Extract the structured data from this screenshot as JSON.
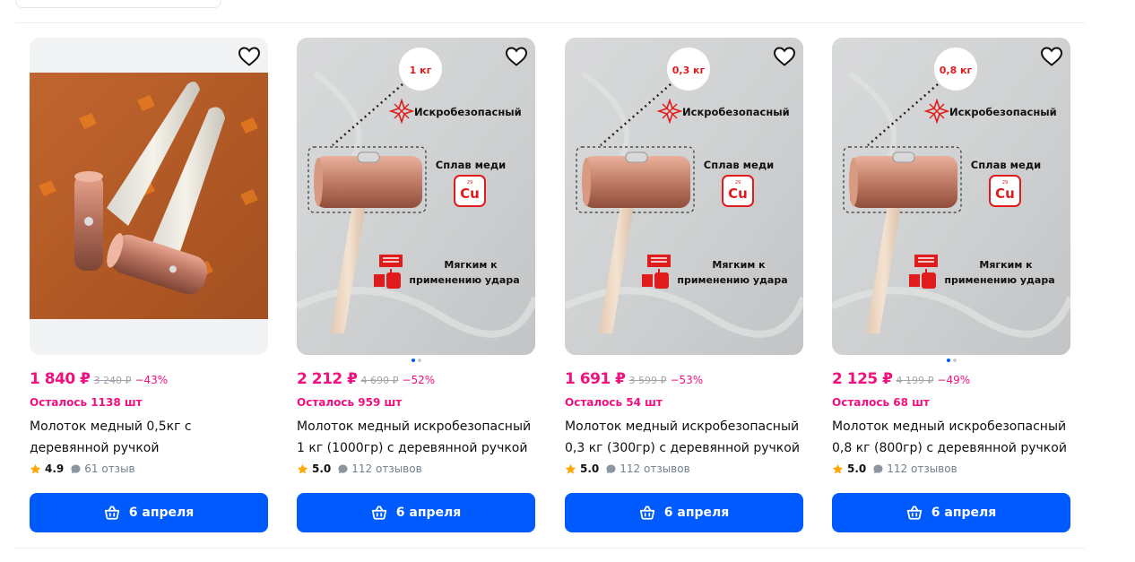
{
  "products": [
    {
      "price": "1 840 ₽",
      "old_price": "3 240 ₽",
      "discount": "−43%",
      "stock": "Осталось 1138 шт",
      "title": "Молоток медный 0,5кг с деревянной ручкой",
      "rating": "4.9",
      "reviews": "61 отзыв",
      "delivery": "6 апреля",
      "image_kind": "photo",
      "image_dots": 0
    },
    {
      "price": "2 212 ₽",
      "old_price": "4 690 ₽",
      "discount": "−52%",
      "stock": "Осталось 959 шт",
      "title": "Молоток медный искробезопасный 1 кг (1000гр) с деревянной ручкой",
      "rating": "5.0",
      "reviews": "112 отзывов",
      "delivery": "6 апреля",
      "image_kind": "infographic",
      "weight_badge": "1 кг",
      "spark_label": "Искробезопасный",
      "alloy_label": "Сплав меди",
      "element_symbol": "Cu",
      "element_number": "29",
      "soft_label": "Мягким к применению удара",
      "image_dots": 2
    },
    {
      "price": "1 691 ₽",
      "old_price": "3 599 ₽",
      "discount": "−53%",
      "stock": "Осталось 54 шт",
      "title": "Молоток медный искробезопасный 0,3 кг (300гр) с деревянной ручкой",
      "rating": "5.0",
      "reviews": "112 отзывов",
      "delivery": "6 апреля",
      "image_kind": "infographic",
      "weight_badge": "0,3 кг",
      "spark_label": "Искробезопасный",
      "alloy_label": "Сплав меди",
      "element_symbol": "Cu",
      "element_number": "29",
      "soft_label": "Мягким к применению удара",
      "image_dots": 0
    },
    {
      "price": "2 125 ₽",
      "old_price": "4 199 ₽",
      "discount": "−49%",
      "stock": "Осталось 68 шт",
      "title": "Молоток медный искробезопасный 0,8 кг (800гр) с деревянной ручкой",
      "rating": "5.0",
      "reviews": "112 отзывов",
      "delivery": "6 апреля",
      "image_kind": "infographic",
      "weight_badge": "0,8 кг",
      "spark_label": "Искробезопасный",
      "alloy_label": "Сплав меди",
      "element_symbol": "Cu",
      "element_number": "29",
      "soft_label": "Мягким к применению удара",
      "image_dots": 2
    }
  ],
  "icons": {
    "favorite": "heart-icon",
    "rating": "star-icon",
    "reviews": "comment-icon",
    "delivery": "basket-icon"
  },
  "colors": {
    "accent": "#005bff",
    "price": "#f1117e",
    "star": "#ffa800"
  }
}
